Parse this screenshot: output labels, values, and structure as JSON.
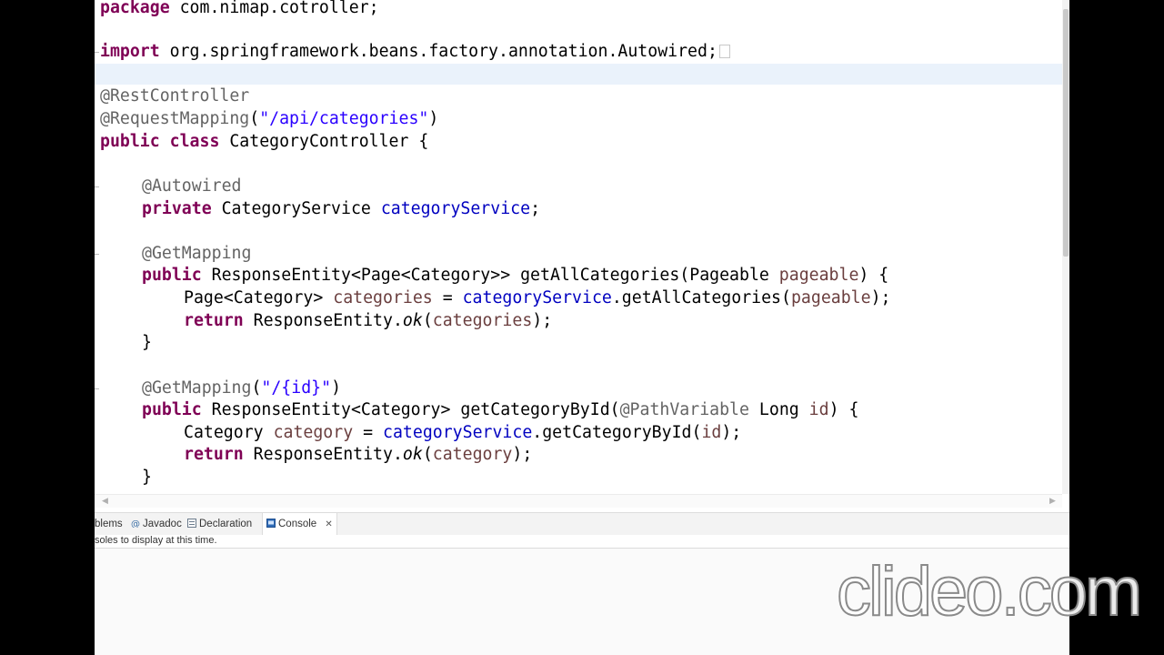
{
  "editor": {
    "lines": {
      "l0": {
        "kw": "package",
        "rest": " com.nimap.cotroller;"
      },
      "l2": {
        "kw": "import",
        "rest": " org.springframework.beans.factory.annotation.Autowired;"
      },
      "l4": {
        "ann": "@RestController"
      },
      "l5": {
        "ann": "@RequestMapping",
        "p1": "(",
        "str": "\"/api/categories\"",
        "p2": ")"
      },
      "l6": {
        "kw": "public class",
        "rest": " CategoryController {"
      },
      "l8": {
        "ann": "@Autowired"
      },
      "l9": {
        "kw": "private",
        "type": " CategoryService ",
        "field": "categoryService",
        "end": ";"
      },
      "l11": {
        "ann": "@GetMapping"
      },
      "l12": {
        "kw": "public",
        "a": " ResponseEntity<Page<Category>> getAllCategories(Pageable ",
        "param": "pageable",
        "b": ") {"
      },
      "l13": {
        "a": "Page<Category> ",
        "var": "categories",
        "b": " = ",
        "field": "categoryService",
        "c": ".getAllCategories(",
        "param": "pageable",
        "d": ");"
      },
      "l14": {
        "kw": "return",
        "a": " ResponseEntity.",
        "ital": "ok",
        "b": "(",
        "var": "categories",
        "c": ");"
      },
      "l15": {
        "a": "}"
      },
      "l17": {
        "ann": "@GetMapping",
        "p1": "(",
        "str": "\"/{id}\"",
        "p2": ")"
      },
      "l18": {
        "kw": "public",
        "a": " ResponseEntity<Category> getCategoryById(",
        "ann": "@PathVariable",
        "b": " Long ",
        "param": "id",
        "c": ") {"
      },
      "l19": {
        "a": "Category ",
        "var": "category",
        "b": " = ",
        "field": "categoryService",
        "c": ".getCategoryById(",
        "param": "id",
        "d": ");"
      },
      "l20": {
        "kw": "return",
        "a": " ResponseEntity.",
        "ital": "ok",
        "b": "(",
        "var": "category",
        "c": ");"
      },
      "l21": {
        "a": "}"
      }
    }
  },
  "bottom_panel": {
    "tabs": [
      {
        "label": "blems",
        "icon": "problems-icon"
      },
      {
        "label": "Javadoc",
        "icon": "javadoc-icon"
      },
      {
        "label": "Declaration",
        "icon": "declaration-icon"
      },
      {
        "label": "Console",
        "icon": "console-icon",
        "active": true,
        "close": "✕"
      }
    ],
    "console_message": "soles to display at this time."
  },
  "watermark": "clideo.com",
  "colors": {
    "keyword": "#7f0055",
    "annotation": "#646464",
    "string": "#2a00ff",
    "field": "#0000c0",
    "local_var": "#6a3e3e"
  }
}
